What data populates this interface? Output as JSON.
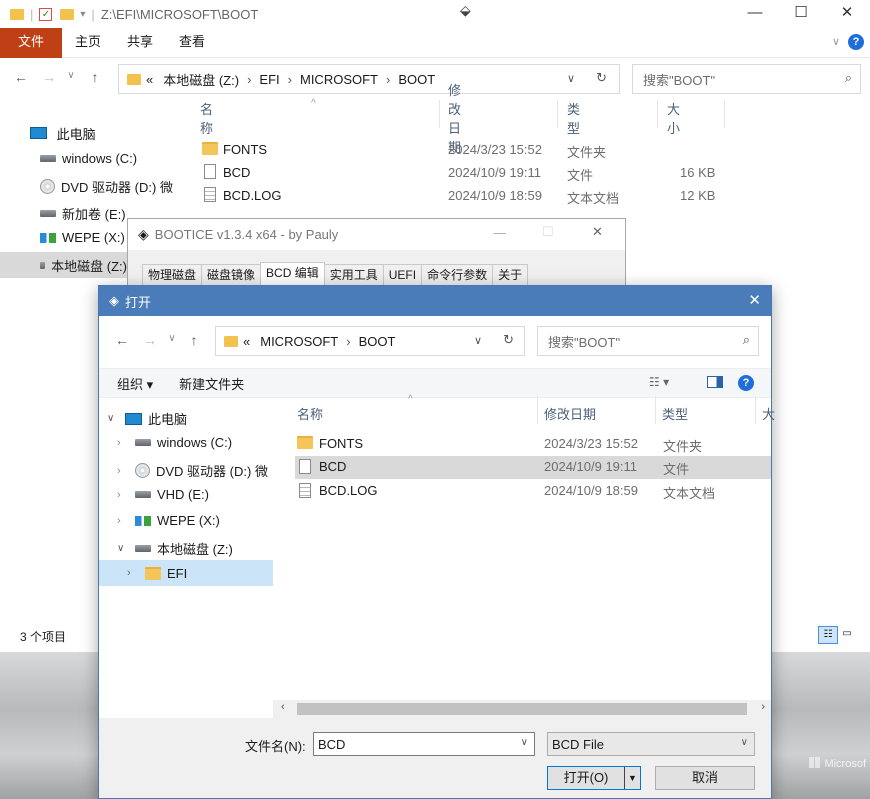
{
  "explorer": {
    "title_path": "Z:\\EFI\\MICROSOFT\\BOOT",
    "window_controls": {
      "minimize": "—",
      "maximize": "☐",
      "close": "✕"
    },
    "ribbon_tabs": [
      "文件",
      "主页",
      "共享",
      "查看"
    ],
    "address": {
      "prefix": "«",
      "crumbs": [
        "本地磁盘 (Z:)",
        "EFI",
        "MICROSOFT",
        "BOOT"
      ]
    },
    "search_placeholder": "搜索\"BOOT\"",
    "columns": {
      "name": "名称",
      "date": "修改日期",
      "type": "类型",
      "size": "大小"
    },
    "files": [
      {
        "name": "FONTS",
        "date": "2024/3/23 15:52",
        "type": "文件夹",
        "size": "",
        "icon": "folder"
      },
      {
        "name": "BCD",
        "date": "2024/10/9 19:11",
        "type": "文件",
        "size": "16 KB",
        "icon": "file"
      },
      {
        "name": "BCD.LOG",
        "date": "2024/10/9 18:59",
        "type": "文本文档",
        "size": "12 KB",
        "icon": "log"
      }
    ],
    "nav": [
      {
        "label": "此电脑",
        "icon": "pc"
      },
      {
        "label": "windows (C:)",
        "icon": "drive"
      },
      {
        "label": "DVD 驱动器 (D:) 微",
        "icon": "dvd"
      },
      {
        "label": "新加卷 (E:)",
        "icon": "drive"
      },
      {
        "label": "WEPE (X:)",
        "icon": "net"
      },
      {
        "label": "本地磁盘 (Z:)",
        "icon": "drive"
      }
    ],
    "status": "3 个项目"
  },
  "bootice": {
    "title": "BOOTICE v1.3.4 x64 - by Pauly",
    "tabs": [
      "物理磁盘",
      "磁盘镜像",
      "BCD 编辑",
      "实用工具",
      "UEFI",
      "命令行参数",
      "关于"
    ],
    "active_tab": "BCD 编辑"
  },
  "dialog": {
    "title": "打开",
    "address": {
      "prefix": "«",
      "crumbs": [
        "MICROSOFT",
        "BOOT"
      ]
    },
    "search_placeholder": "搜索\"BOOT\"",
    "toolbar": {
      "organize": "组织 ▾",
      "new_folder": "新建文件夹"
    },
    "columns": {
      "name": "名称",
      "date": "修改日期",
      "type": "类型",
      "size": "大"
    },
    "files": [
      {
        "name": "FONTS",
        "date": "2024/3/23 15:52",
        "type": "文件夹",
        "icon": "folder"
      },
      {
        "name": "BCD",
        "date": "2024/10/9 19:11",
        "type": "文件",
        "icon": "file"
      },
      {
        "name": "BCD.LOG",
        "date": "2024/10/9 18:59",
        "type": "文本文档",
        "icon": "log"
      }
    ],
    "nav": [
      {
        "label": "此电脑",
        "icon": "pc"
      },
      {
        "label": "windows (C:)",
        "icon": "drive"
      },
      {
        "label": "DVD 驱动器 (D:) 微",
        "icon": "dvd"
      },
      {
        "label": "VHD (E:)",
        "icon": "drive"
      },
      {
        "label": "WEPE (X:)",
        "icon": "net"
      },
      {
        "label": "本地磁盘 (Z:)",
        "icon": "drive"
      },
      {
        "label": "EFI",
        "icon": "folder"
      }
    ],
    "filename_label": "文件名(N):",
    "filename_value": "BCD",
    "filter": "BCD File",
    "open_label": "打开(O)",
    "cancel_label": "取消"
  },
  "watermark": "Microsof",
  "colors": {
    "ribbon_file": "#c04015",
    "dialog_title": "#4b7cba",
    "selection": "#cce4f7"
  }
}
